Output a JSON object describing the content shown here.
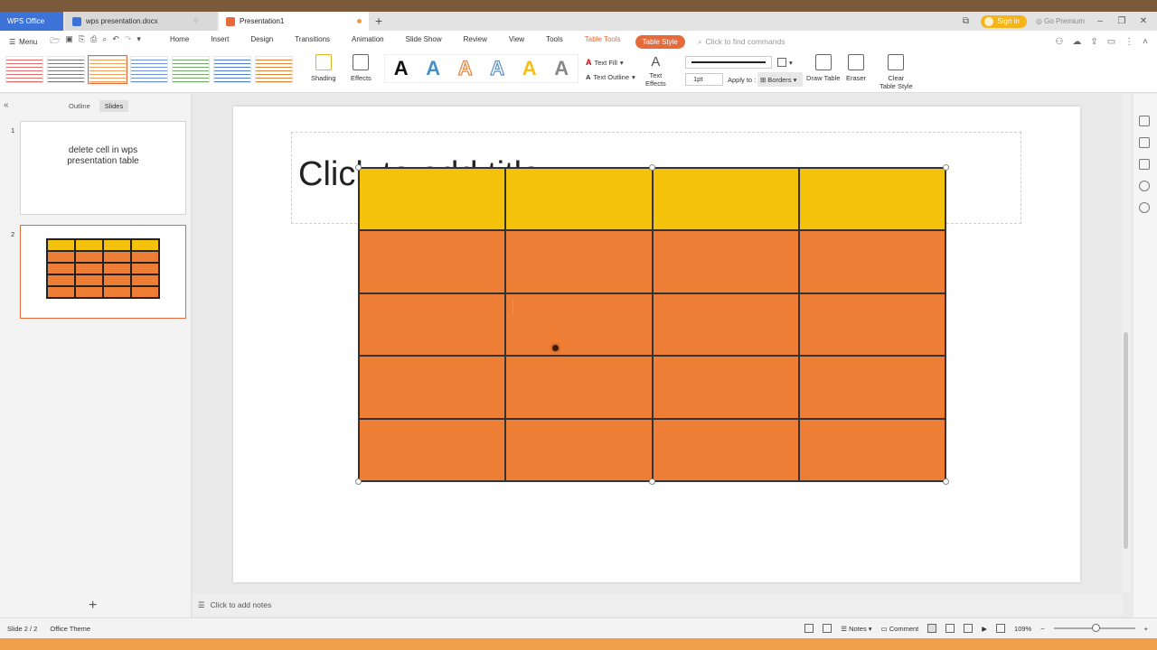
{
  "tabs": {
    "wps": "WPS Office",
    "doc": "wps presentation.docx",
    "ppt": "Presentation1"
  },
  "titlebar": {
    "signin": "Sign in",
    "premium": "Go Premium"
  },
  "menu": {
    "menu_label": "Menu",
    "items": [
      "Home",
      "Insert",
      "Design",
      "Transitions",
      "Animation",
      "Slide Show",
      "Review",
      "View",
      "Tools"
    ],
    "table_tools": "Table Tools",
    "table_style": "Table Style",
    "search_placeholder": "Click to find commands"
  },
  "ribbon": {
    "shading": "Shading",
    "effects": "Effects",
    "text_fill": "Text Fill",
    "text_outline": "Text Outline",
    "text_effects_1": "Text",
    "text_effects_2": "Effects",
    "line_weight": "1pt",
    "apply_to": "Apply to :",
    "borders": "Borders",
    "draw_table": "Draw Table",
    "eraser": "Eraser",
    "clear_1": "Clear",
    "clear_2": "Table Style",
    "wordart_glyph": "A"
  },
  "left_panel": {
    "outline_tab": "Outline",
    "slides_tab": "Slides",
    "slide1_num": "1",
    "slide1_text_1": "delete cell in wps",
    "slide1_text_2": "presentation table",
    "slide2_num": "2"
  },
  "slide": {
    "title_placeholder": "Click to add title",
    "header_color": "#f5c20b",
    "body_color": "#ee7d35",
    "rows": 5,
    "cols": 4
  },
  "notes": {
    "placeholder": "Click to add notes"
  },
  "status": {
    "slide_count": "Slide 2 / 2",
    "theme": "Office Theme",
    "notes_btn": "Notes",
    "comment_btn": "Comment",
    "zoom": "109%"
  }
}
